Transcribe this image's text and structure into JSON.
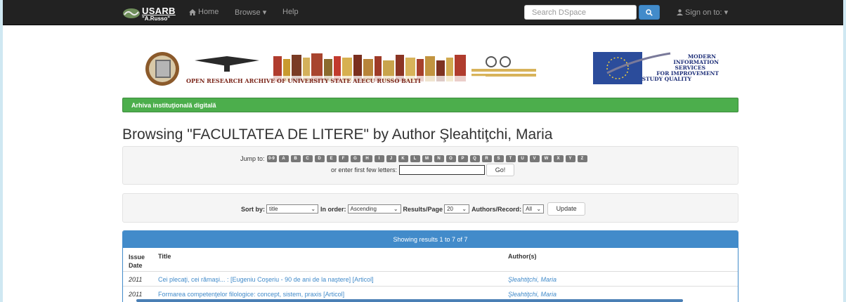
{
  "navbar": {
    "brand": "USARB",
    "brand_sub": "\"A.Russo\"",
    "home": "Home",
    "browse": "Browse",
    "help": "Help",
    "search_placeholder": "Search DSpace",
    "signin": "Sign on to:"
  },
  "banner": {
    "left_text": "OPEN RESEARCH ARCHIVE OF UNIVERSITY STATE ALECU RUSSO BALTI",
    "right_text": [
      "MODERN",
      "INFORMATION",
      "SERVICES",
      "FOR IMPROVEMENT",
      "STUDY QUALITY"
    ]
  },
  "trail": "Arhiva instituţională digitală",
  "heading": "Browsing \"FACULTATEA DE LITERE\" by Author Şleahtiţchi, Maria",
  "jump": {
    "label": "Jump to:",
    "letters": [
      "0-9",
      "A",
      "B",
      "C",
      "D",
      "E",
      "F",
      "G",
      "H",
      "I",
      "J",
      "K",
      "L",
      "M",
      "N",
      "O",
      "P",
      "Q",
      "R",
      "S",
      "T",
      "U",
      "V",
      "W",
      "X",
      "Y",
      "Z"
    ],
    "first_label": "or enter first few letters:",
    "go": "Go!"
  },
  "sort": {
    "sort_by_label": "Sort by:",
    "sort_by_value": "title",
    "order_label": "In order:",
    "order_value": "Ascending",
    "rpp_label": "Results/Page",
    "rpp_value": "20",
    "authors_label": "Authors/Record:",
    "authors_value": "All",
    "update": "Update"
  },
  "results": {
    "header": "Showing results 1 to 7 of 7",
    "col_date": "Issue Date",
    "col_title": "Title",
    "col_author": "Author(s)",
    "rows": [
      {
        "date": "2011",
        "title": "Cei plecaţi, cei rămaşi... : [Eugeniu Coşeriu - 90 de ani de la naştere] [Articol]",
        "author": "Şleahtiţchi, Maria"
      },
      {
        "date": "2011",
        "title": "Formarea competenţelor filologice: concept, sistem, praxis [Articol]",
        "author": "Şleahtiţchi, Maria"
      }
    ]
  },
  "colors": {
    "navbar": "#222222",
    "primary": "#428bca",
    "success": "#4cae4c"
  }
}
